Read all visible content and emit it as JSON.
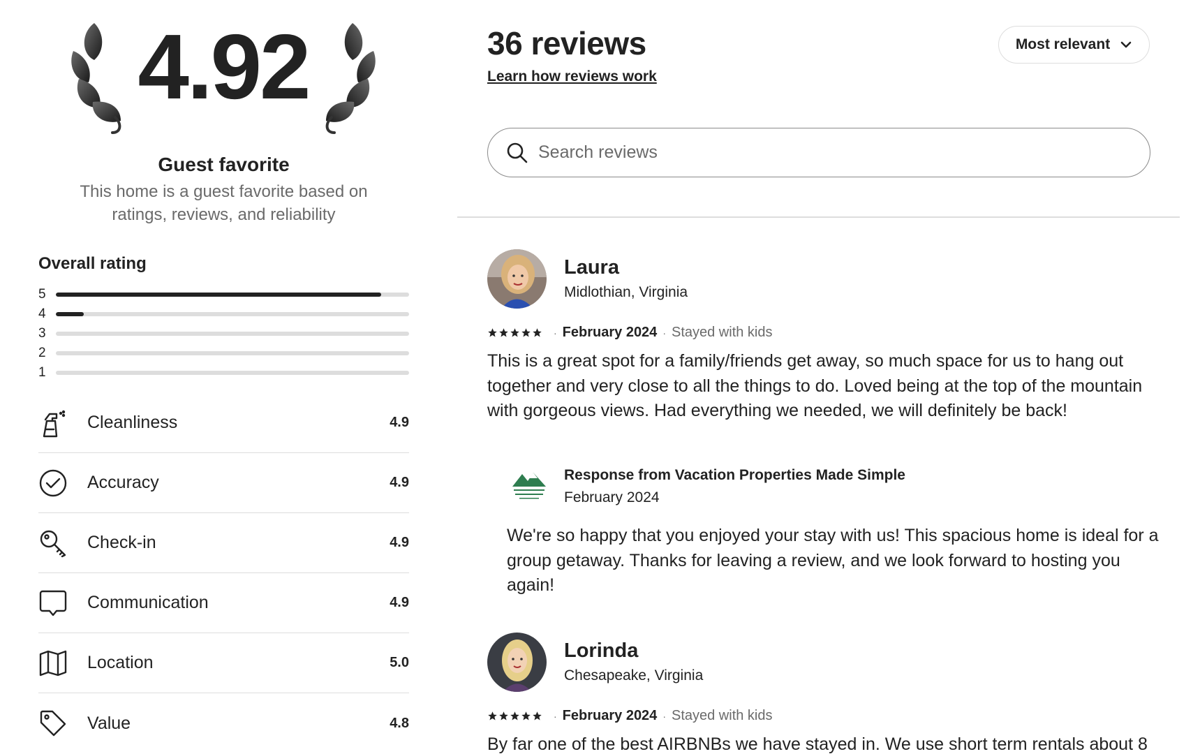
{
  "summary": {
    "rating": "4.92",
    "guest_favorite_title": "Guest favorite",
    "guest_favorite_desc": "This home is a guest favorite based on ratings, reviews, and reliability",
    "overall_label": "Overall rating",
    "distribution": [
      {
        "stars": "5",
        "fraction": 0.92
      },
      {
        "stars": "4",
        "fraction": 0.08
      },
      {
        "stars": "3",
        "fraction": 0
      },
      {
        "stars": "2",
        "fraction": 0
      },
      {
        "stars": "1",
        "fraction": 0
      }
    ]
  },
  "categories": [
    {
      "label": "Cleanliness",
      "value": "4.9",
      "icon": "spray-bottle-icon"
    },
    {
      "label": "Accuracy",
      "value": "4.9",
      "icon": "check-circle-icon"
    },
    {
      "label": "Check-in",
      "value": "4.9",
      "icon": "key-icon"
    },
    {
      "label": "Communication",
      "value": "4.9",
      "icon": "chat-bubble-icon"
    },
    {
      "label": "Location",
      "value": "5.0",
      "icon": "map-icon"
    },
    {
      "label": "Value",
      "value": "4.8",
      "icon": "tag-icon"
    }
  ],
  "reviews_header": {
    "count": "36 reviews",
    "learn_link": "Learn how reviews work",
    "sort_label": "Most relevant",
    "search_placeholder": "Search reviews"
  },
  "reviews": [
    {
      "name": "Laura",
      "location": "Midlothian, Virginia",
      "stars": 5,
      "date": "February 2024",
      "stay": "Stayed with kids",
      "text": "This is a great spot for a family/friends get away, so much space for us to hang out together and very close to all the things to do. Loved being at the top of the mountain with gorgeous views. Had everything we needed, we will definitely be back!",
      "response": {
        "from": "Response from Vacation Properties Made Simple",
        "date": "February 2024",
        "text": "We're so happy that you enjoyed your stay with us! This spacious home is ideal for a group getaway. Thanks for leaving a review, and we look forward to hosting you again!"
      }
    },
    {
      "name": "Lorinda",
      "location": "Chesapeake, Virginia",
      "stars": 5,
      "date": "February 2024",
      "stay": "Stayed with kids",
      "text": "By far one of the best AIRBNBs we have stayed in. We use short term rentals about 8"
    }
  ],
  "colors": {
    "text": "#222222",
    "muted": "#6a6a6a",
    "divider": "#dddddd",
    "bar_fill": "#222222",
    "bar_track": "#dddddd"
  }
}
